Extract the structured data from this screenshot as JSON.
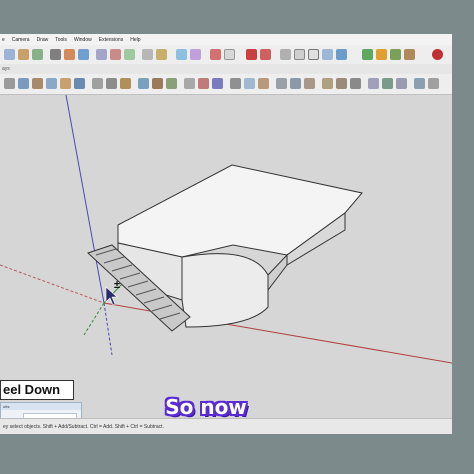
{
  "menu": {
    "items": [
      "e",
      "Camera",
      "Draw",
      "Tools",
      "Window",
      "Extensions",
      "Help"
    ]
  },
  "toolbar": {
    "strip_label": "ays"
  },
  "caption": {
    "label": "eel Down"
  },
  "entity_panel": {
    "title": "utts"
  },
  "status": {
    "text": "ey select objects. Shift + Add/Subtract. Ctrl = Add. Shift + Ctrl = Subtract."
  },
  "subtitle": {
    "text": "So now"
  },
  "cursor": {
    "modifier": "±"
  },
  "colors": {
    "frame": "#7c8a8c",
    "viewport": "#d6d6d6",
    "subtitle_outline": "#5b2cd6",
    "model_face": "#f4f4f4"
  }
}
